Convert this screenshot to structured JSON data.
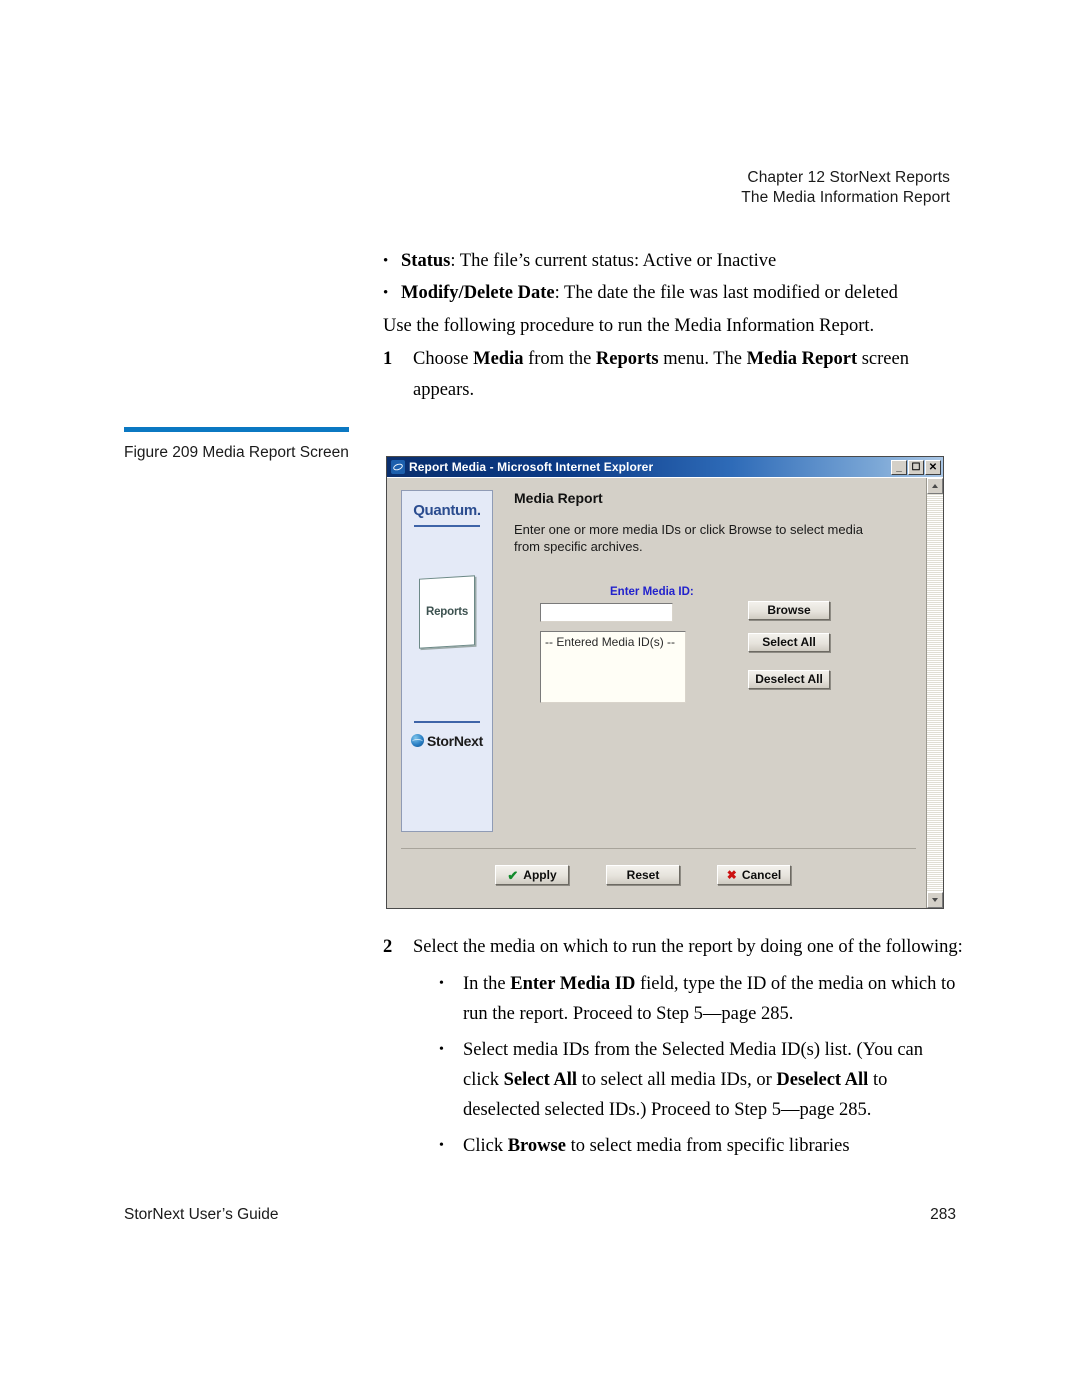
{
  "header": {
    "line1": "Chapter 12  StorNext Reports",
    "line2": "The Media Information Report"
  },
  "body": {
    "bullet1_label": "Status",
    "bullet1_text": ": The file’s current status: Active or Inactive",
    "bullet2_label": "Modify/Delete Date",
    "bullet2_text": ": The date the file was last modified or deleted",
    "paragraph": "Use the following procedure to run the Media Information Report.",
    "step1_number": "1",
    "step1_a": "Choose ",
    "step1_b1": "Media",
    "step1_c": " from the ",
    "step1_b2": "Reports",
    "step1_d": " menu. The ",
    "step1_b3": "Media Report",
    "step1_e": " screen appears."
  },
  "figure": {
    "caption": "Figure 209  Media Report Screen",
    "rule_color": "#0b78c2"
  },
  "window": {
    "title": "Report Media - Microsoft Internet Explorer",
    "icon": "internet-explorer-icon",
    "minimize_label": "_",
    "maximize_label": "❐",
    "close_label": "✕"
  },
  "brand": {
    "quantum": "Quantum.",
    "card_label": "Reports",
    "stornext": "StorNext",
    "panel_bg": "#e4eaf7",
    "logo_color": "#2a4c8f"
  },
  "form": {
    "title": "Media Report",
    "description": "Enter one or more media IDs or click Browse to select media from specific archives.",
    "media_id_label": "Enter Media ID:",
    "media_id_label_color": "#2222cc",
    "media_id_value": "",
    "media_id_placeholder": "",
    "listbox_text": "-- Entered Media ID(s) --",
    "buttons": {
      "browse": "Browse",
      "select_all": "Select All",
      "deselect_all": "Deselect All",
      "apply": "Apply",
      "reset": "Reset",
      "cancel": "Cancel"
    },
    "apply_icon": "✔",
    "cancel_icon": "✖",
    "apply_icon_color": "#128a2c",
    "cancel_icon_color": "#cc1111"
  },
  "lower": {
    "step2_number": "2",
    "step2_text": "Select the media on which to run the report by doing one of the following:",
    "sub1_a": "In the ",
    "sub1_b": "Enter Media ID",
    "sub1_c": " field, type the ID of the media on which to run the report. Proceed to Step 5—page 285.",
    "sub2_a": "Select media IDs from the Selected Media ID(s) list. (You can click ",
    "sub2_b1": "Select All",
    "sub2_c": " to select all media IDs, or ",
    "sub2_b2": "Deselect All",
    "sub2_d": " to deselected selected IDs.) Proceed to Step 5—page 285.",
    "sub3_a": "Click ",
    "sub3_b": "Browse",
    "sub3_c": " to select media from specific libraries"
  },
  "footer": {
    "left": "StorNext User’s Guide",
    "right": "283"
  }
}
